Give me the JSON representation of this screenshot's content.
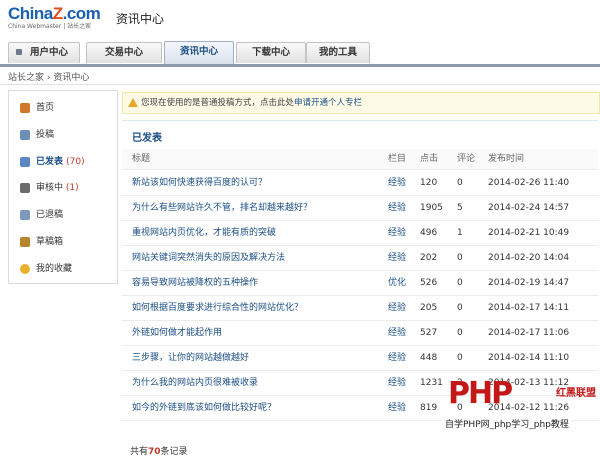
{
  "header": {
    "logo_main": "China",
    "logo_z": "Z",
    "logo_end": ".com",
    "logo_sub": "China Webmaster | 站长之家",
    "title": "资讯中心"
  },
  "nav": {
    "tabs": [
      {
        "label": "用户中心",
        "active": false
      },
      {
        "label": "交易中心",
        "active": false
      },
      {
        "label": "资讯中心",
        "active": true
      },
      {
        "label": "下载中心",
        "active": false
      },
      {
        "label": "我的工具",
        "active": false
      }
    ]
  },
  "breadcrumb": "站长之家 › 资讯中心",
  "sidebar": {
    "items": [
      {
        "label": "首页",
        "count": "",
        "icon": "home-icon",
        "color": "#d0792b"
      },
      {
        "label": "投稿",
        "count": "",
        "icon": "pencil-icon",
        "color": "#6b8fb6"
      },
      {
        "label": "已发表",
        "count": "(70)",
        "icon": "document-icon",
        "color": "#5b87c4",
        "active": true
      },
      {
        "label": "审核中",
        "count": "(1)",
        "icon": "review-icon",
        "color": "#6b6b6b"
      },
      {
        "label": "已退稿",
        "count": "",
        "icon": "return-icon",
        "color": "#7a99bd"
      },
      {
        "label": "草稿箱",
        "count": "",
        "icon": "draft-icon",
        "color": "#b9842e"
      },
      {
        "label": "我的收藏",
        "count": "",
        "icon": "star-icon",
        "color": "#e7b12c"
      }
    ]
  },
  "notice": {
    "text": "您现在使用的是普通投稿方式，点击此处",
    "link": "申请开通个人专栏"
  },
  "panel": {
    "title": "已发表",
    "columns": [
      "标题",
      "栏目",
      "点击",
      "评论",
      "发布时间"
    ],
    "rows": [
      [
        "新站该如何快速获得百度的认可？",
        "经验",
        "120",
        "0",
        "2014-02-26 11:40"
      ],
      [
        "为什么有些网站许久不管，排名却越来越好？",
        "经验",
        "1905",
        "5",
        "2014-02-24 14:57"
      ],
      [
        "重视网站内页优化，才能有质的突破",
        "经验",
        "496",
        "1",
        "2014-02-21 10:49"
      ],
      [
        "网站关键词突然消失的原因及解决方法",
        "经验",
        "202",
        "0",
        "2014-02-20 14:04"
      ],
      [
        "容易导致网站被降权的五种操作",
        "优化",
        "526",
        "0",
        "2014-02-19 14:47"
      ],
      [
        "如何根据百度要求进行综合性的网站优化？",
        "经验",
        "205",
        "0",
        "2014-02-17 14:11"
      ],
      [
        "外链如何做才能起作用",
        "经验",
        "527",
        "0",
        "2014-02-17 11:06"
      ],
      [
        "三步骤，让你的网站越做越好",
        "经验",
        "448",
        "0",
        "2014-02-14 11:10"
      ],
      [
        "为什么我的网站内页很难被收录",
        "经验",
        "1231",
        "2",
        "2014-02-13 11:12"
      ],
      [
        "如今的外链到底该如何做比较好呢？",
        "经验",
        "819",
        "0",
        "2014-02-12 11:26"
      ]
    ],
    "total_prefix": "共有",
    "total_count": "70",
    "total_suffix": "条记录"
  },
  "watermark": {
    "logo": "PHP",
    "sub": "红黑联盟",
    "foot": "自学PHP网_php学习_php教程"
  }
}
